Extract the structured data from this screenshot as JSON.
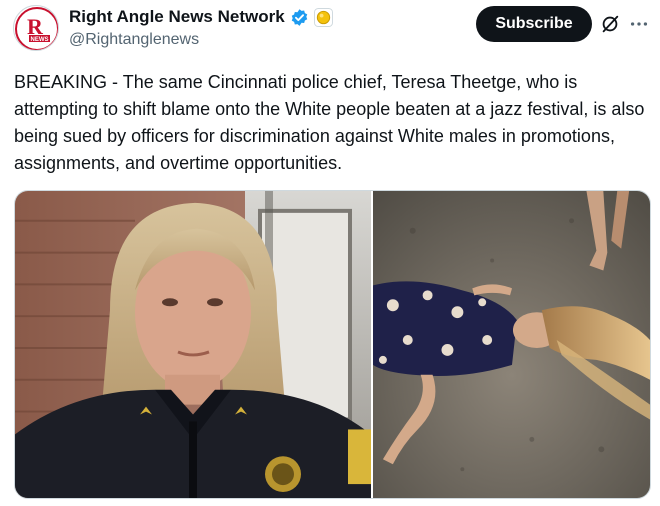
{
  "account": {
    "display_name": "Right Angle News Network",
    "handle": "@Rightanglenews",
    "avatar_logo_text": "R",
    "avatar_logo_subtext": "NEWS"
  },
  "actions": {
    "subscribe_label": "Subscribe"
  },
  "icons": {
    "verified": "verified-badge-icon",
    "affiliate": "affiliate-badge-icon",
    "grok": "grok-icon",
    "more": "more-options-icon"
  },
  "tweet": {
    "text": "BREAKING - The same Cincinnati police chief, Teresa Theetge, who is attempting to shift blame onto the White people beaten at a jazz festival, is also being sued by officers for discrimination against White males in promotions, assignments, and overtime opportunities."
  },
  "media": {
    "photos": [
      {
        "name": "police-chief-photo"
      },
      {
        "name": "street-photo"
      }
    ]
  },
  "colors": {
    "text_primary": "#0f1419",
    "text_secondary": "#536471",
    "verified_blue": "#1d9bf0",
    "affiliate_gold": "#f4c20d",
    "subscribe_bg": "#0f1419",
    "brand_red": "#c8102e"
  }
}
